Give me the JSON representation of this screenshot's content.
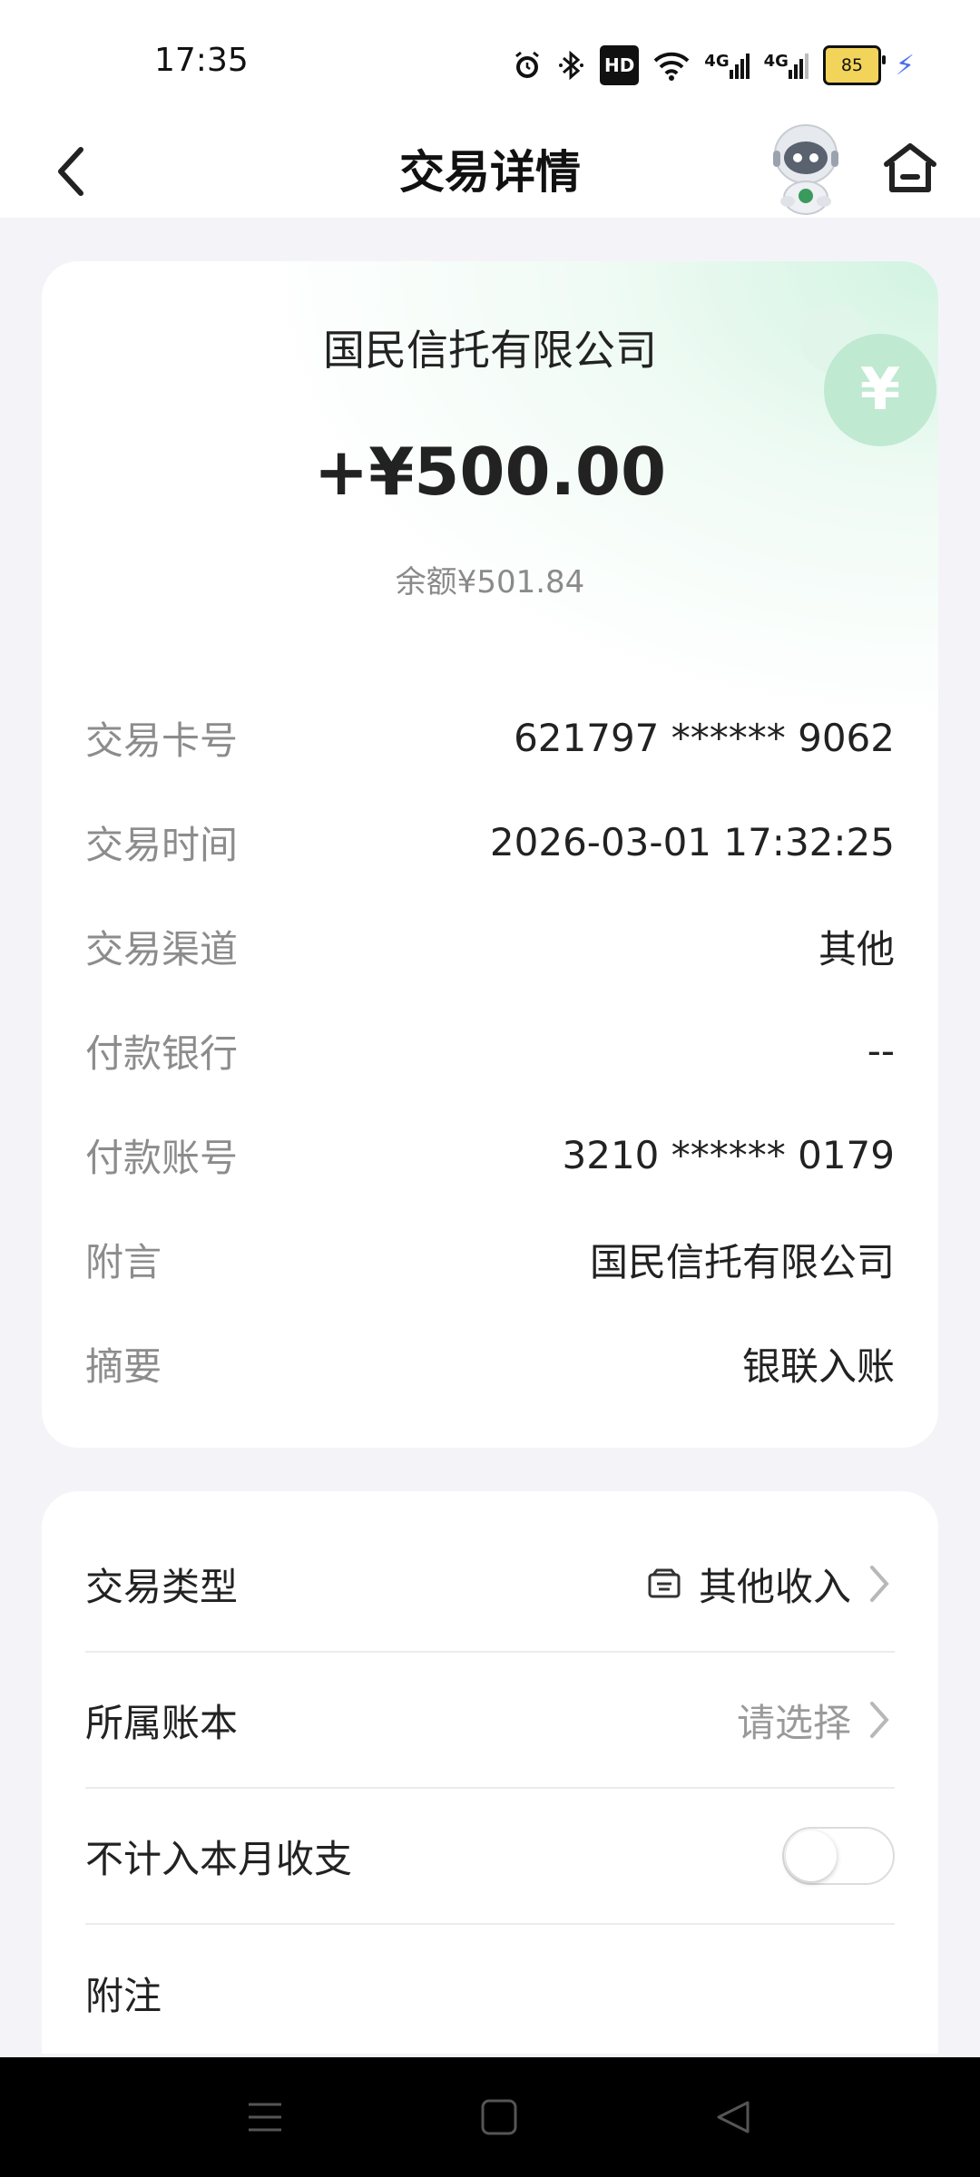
{
  "status_bar": {
    "time": "17:35",
    "hd_label": "HD",
    "net1": "4G",
    "net2": "4G",
    "battery": "85"
  },
  "header": {
    "title": "交易详情"
  },
  "summary": {
    "payer": "国民信托有限公司",
    "amount": "+¥500.00",
    "balance": "余额¥501.84",
    "coin_symbol": "¥"
  },
  "details": [
    {
      "label": "交易卡号",
      "value": "621797 ****** 9062"
    },
    {
      "label": "交易时间",
      "value": "2026-03-01 17:32:25"
    },
    {
      "label": "交易渠道",
      "value": "其他"
    },
    {
      "label": "付款银行",
      "value": "--"
    },
    {
      "label": "付款账号",
      "value": "3210 ****** 0179"
    },
    {
      "label": "附言",
      "value": "国民信托有限公司"
    },
    {
      "label": "摘要",
      "value": "银联入账"
    }
  ],
  "options": {
    "type_label": "交易类型",
    "type_value": "其他收入",
    "book_label": "所属账本",
    "book_placeholder": "请选择",
    "exclude_label": "不计入本月收支",
    "exclude_on": false,
    "note_label": "附注"
  },
  "colors": {
    "accent_green": "#bfe9d1",
    "page_bg": "#f4f4f8"
  }
}
